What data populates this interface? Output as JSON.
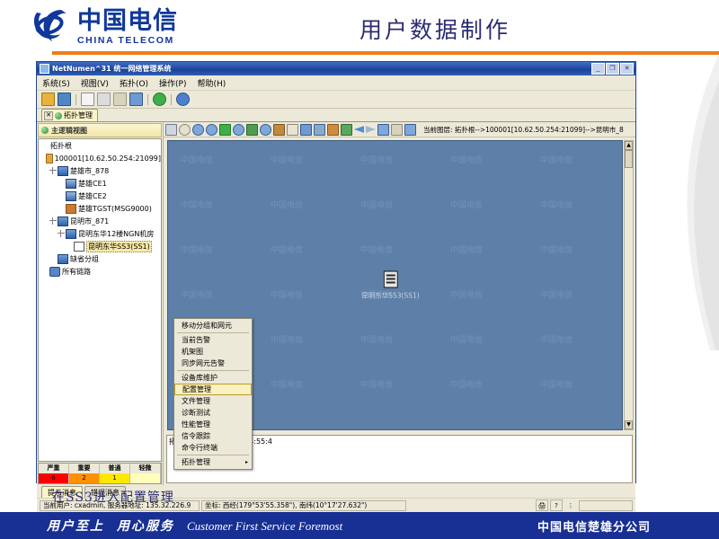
{
  "slide": {
    "title": "用户数据制作",
    "caption": "在SS3进入配置管理",
    "logo_cn": "中国电信",
    "logo_en": "CHINA TELECOM",
    "accent_orange": "#ef7c1a",
    "brand_blue": "#10379a"
  },
  "footer": {
    "slogan_cn_1": "用户至上",
    "slogan_cn_2": "用心服务",
    "slogan_en": "Customer First Service Foremost",
    "company": "中国电信楚雄分公司",
    "bg": "#182f94"
  },
  "app": {
    "title": "NetNumen^31 统一网络管理系统",
    "window_buttons": [
      "_",
      "❐",
      "✕"
    ],
    "menus": [
      {
        "label": "系统(S)"
      },
      {
        "label": "视图(V)"
      },
      {
        "label": "拓扑(O)"
      },
      {
        "label": "操作(P)"
      },
      {
        "label": "帮助(H)"
      }
    ],
    "toolbar_icons": [
      "lock-icon",
      "user-icon",
      "new-icon",
      "copy-icon",
      "cut-icon",
      "paste-icon",
      "refresh-icon",
      "globe-icon"
    ],
    "tabs": [
      {
        "label": "拓扑管理",
        "icon": "globe-icon",
        "active": true
      }
    ]
  },
  "tree": {
    "header": "主逻辑视图",
    "header_icon": "globe-icon",
    "nodes": [
      {
        "label": "拓扑根",
        "indent": 0,
        "icon": "none",
        "expander": false,
        "selected": false
      },
      {
        "label": "100001[10.62.50.254:21099]",
        "indent": 0,
        "icon": "root",
        "expander": false,
        "selected": false
      },
      {
        "label": "楚雄市_878",
        "indent": 1,
        "icon": "group",
        "expander": true,
        "selected": false
      },
      {
        "label": "楚雄CE1",
        "indent": 2,
        "icon": "ne",
        "expander": false,
        "selected": false
      },
      {
        "label": "楚雄CE2",
        "indent": 2,
        "icon": "ne",
        "expander": false,
        "selected": false
      },
      {
        "label": "楚雄TGST(MSG9000)",
        "indent": 2,
        "icon": "srv",
        "expander": false,
        "selected": false
      },
      {
        "label": "昆明市_871",
        "indent": 1,
        "icon": "group",
        "expander": true,
        "selected": false
      },
      {
        "label": "昆明东华12楼NGN机房",
        "indent": 2,
        "icon": "group",
        "expander": true,
        "selected": false
      },
      {
        "label": "昆明东华SS3(SS1)",
        "indent": 3,
        "icon": "dev",
        "expander": false,
        "selected": true
      },
      {
        "label": "缺省分组",
        "indent": 1,
        "icon": "group",
        "expander": false,
        "selected": false
      },
      {
        "label": "所有链路",
        "indent": 0,
        "icon": "link",
        "expander": false,
        "selected": false
      }
    ]
  },
  "alarm_table": {
    "headers": [
      "严重",
      "重要",
      "普通",
      "轻微"
    ],
    "values": [
      "6",
      "2",
      "1",
      ""
    ],
    "colors": [
      "#ff0000",
      "#ff9000",
      "#ffe800",
      "#ffffbb"
    ]
  },
  "context_menu": {
    "items": [
      {
        "label": "移动分组和网元",
        "highlight": false,
        "submenu": false,
        "sep_after": true
      },
      {
        "label": "当前告警",
        "highlight": false,
        "submenu": false,
        "sep_after": false
      },
      {
        "label": "机架图",
        "highlight": false,
        "submenu": false,
        "sep_after": false
      },
      {
        "label": "同步网元告警",
        "highlight": false,
        "submenu": false,
        "sep_after": true
      },
      {
        "label": "设备库维护",
        "highlight": false,
        "submenu": false,
        "sep_after": false
      },
      {
        "label": "配置管理",
        "highlight": true,
        "submenu": false,
        "sep_after": false
      },
      {
        "label": "文件管理",
        "highlight": false,
        "submenu": false,
        "sep_after": false
      },
      {
        "label": "诊断测试",
        "highlight": false,
        "submenu": false,
        "sep_after": false
      },
      {
        "label": "性能管理",
        "highlight": false,
        "submenu": false,
        "sep_after": false
      },
      {
        "label": "信令跟踪",
        "highlight": false,
        "submenu": false,
        "sep_after": false
      },
      {
        "label": "命令行终端",
        "highlight": false,
        "submenu": false,
        "sep_after": true
      },
      {
        "label": "拓扑管理",
        "highlight": false,
        "submenu": true,
        "sep_after": false
      }
    ],
    "submenu_arrow": "▸"
  },
  "canvas": {
    "layer_path": "当前图层: 拓扑根-->100001[10.62.50.254:21099]-->昆明市_8",
    "background": "#5d7fa8",
    "node": {
      "label": "昆明东华SS3(SS1)",
      "icon": "network-element-icon"
    },
    "watermark_text": "中国电信",
    "toolbar_icons": [
      "select-arrow-icon",
      "undo-icon",
      "zoom-out-icon",
      "zoom-in-icon",
      "home-icon",
      "magnifier-icon",
      "fit-icon",
      "search-icon",
      "link-icon",
      "frame-icon",
      "save-icon",
      "find-icon",
      "grid-icon",
      "export-icon",
      "back-arrow-icon",
      "forward-arrow-icon",
      "refresh-icon",
      "table-icon",
      "layout-icon"
    ]
  },
  "log": {
    "line": "拓扑管理(2009-09-29 14:55:4",
    "tabs": [
      {
        "label": "提示消息",
        "active": true
      },
      {
        "label": "错误消息",
        "active": false
      }
    ]
  },
  "statusbar": {
    "user_info": "当前用户: cxadmin, 服务器地址: 135.32.226.9",
    "coords": "坐标: 西经(179°53'55.358\"), 南纬(10°17'27.632\")",
    "icons": [
      "printer-icon",
      "help-icon",
      "resize-grip-icon"
    ]
  }
}
